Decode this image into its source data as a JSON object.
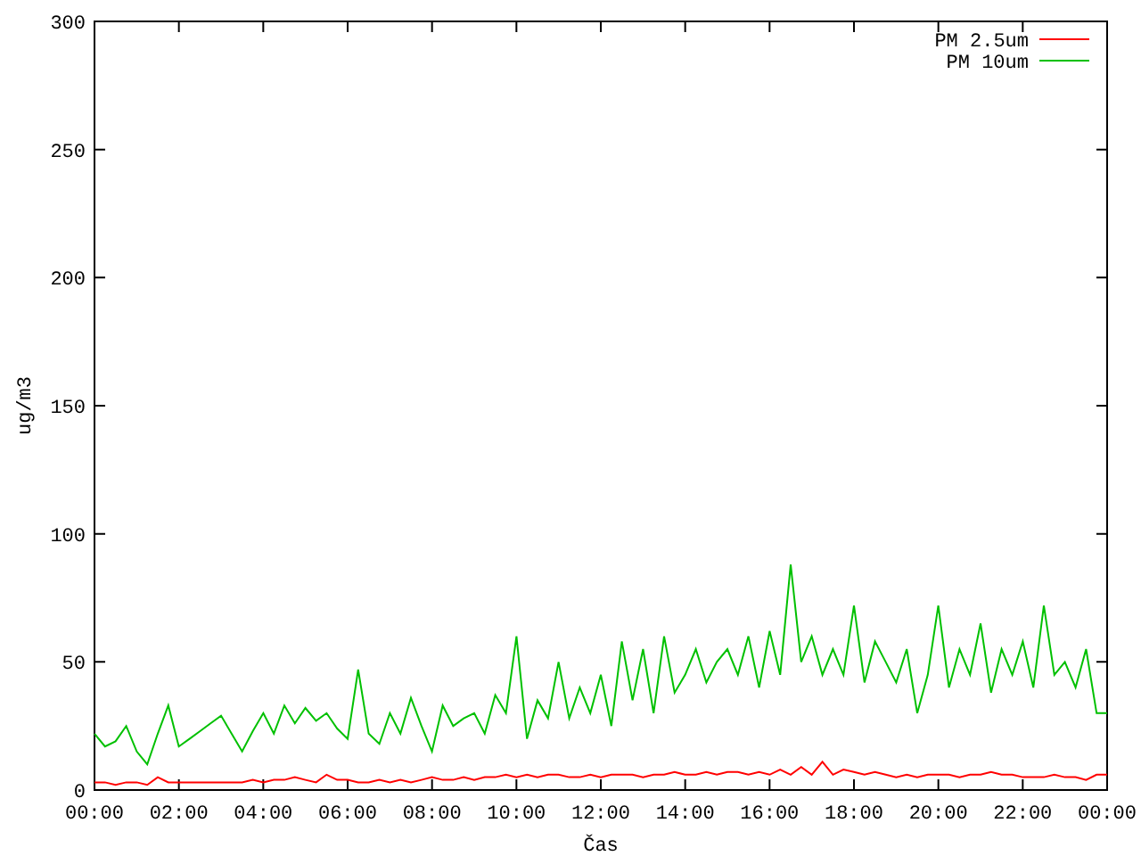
{
  "chart_data": {
    "type": "line",
    "xlabel": "Čas",
    "ylabel": "ug/m3",
    "x": [
      0,
      0.25,
      0.5,
      0.75,
      1,
      1.25,
      1.5,
      1.75,
      2,
      2.25,
      2.5,
      2.75,
      3,
      3.25,
      3.5,
      3.75,
      4,
      4.25,
      4.5,
      4.75,
      5,
      5.25,
      5.5,
      5.75,
      6,
      6.25,
      6.5,
      6.75,
      7,
      7.25,
      7.5,
      7.75,
      8,
      8.25,
      8.5,
      8.75,
      9,
      9.25,
      9.5,
      9.75,
      10,
      10.25,
      10.5,
      10.75,
      11,
      11.25,
      11.5,
      11.75,
      12,
      12.25,
      12.5,
      12.75,
      13,
      13.25,
      13.5,
      13.75,
      14,
      14.25,
      14.5,
      14.75,
      15,
      15.25,
      15.5,
      15.75,
      16,
      16.25,
      16.5,
      16.75,
      17,
      17.25,
      17.5,
      17.75,
      18,
      18.25,
      18.5,
      18.75,
      19,
      19.25,
      19.5,
      19.75,
      20,
      20.25,
      20.5,
      20.75,
      21,
      21.25,
      21.5,
      21.75,
      22,
      22.25,
      22.5,
      22.75,
      23,
      23.25,
      23.5,
      23.75,
      24
    ],
    "series": [
      {
        "name": "PM 2.5um",
        "color": "#ff0000",
        "values": [
          3,
          3,
          2,
          3,
          3,
          2,
          5,
          3,
          3,
          3,
          3,
          3,
          3,
          3,
          3,
          4,
          3,
          4,
          4,
          5,
          4,
          3,
          6,
          4,
          4,
          3,
          3,
          4,
          3,
          4,
          3,
          4,
          5,
          4,
          4,
          5,
          4,
          5,
          5,
          6,
          5,
          6,
          5,
          6,
          6,
          5,
          5,
          6,
          5,
          6,
          6,
          6,
          5,
          6,
          6,
          7,
          6,
          6,
          7,
          6,
          7,
          7,
          6,
          7,
          6,
          8,
          6,
          9,
          6,
          11,
          6,
          8,
          7,
          6,
          7,
          6,
          5,
          6,
          5,
          6,
          6,
          6,
          5,
          6,
          6,
          7,
          6,
          6,
          5,
          5,
          5,
          6,
          5,
          5,
          4,
          6,
          6
        ]
      },
      {
        "name": "PM 10um",
        "color": "#00c000",
        "values": [
          22,
          17,
          19,
          25,
          15,
          10,
          22,
          33,
          17,
          20,
          23,
          26,
          29,
          22,
          15,
          23,
          30,
          22,
          33,
          26,
          32,
          27,
          30,
          24,
          20,
          47,
          22,
          18,
          30,
          22,
          36,
          25,
          15,
          33,
          25,
          28,
          30,
          22,
          37,
          30,
          60,
          20,
          35,
          28,
          50,
          28,
          40,
          30,
          45,
          25,
          58,
          35,
          55,
          30,
          60,
          38,
          45,
          55,
          42,
          50,
          55,
          45,
          60,
          40,
          62,
          45,
          88,
          50,
          60,
          45,
          55,
          45,
          72,
          42,
          58,
          50,
          42,
          55,
          30,
          45,
          72,
          40,
          55,
          45,
          65,
          38,
          55,
          45,
          58,
          40,
          72,
          45,
          50,
          40,
          55,
          30,
          30
        ]
      }
    ],
    "xlim": [
      0,
      24
    ],
    "ylim": [
      0,
      300
    ],
    "xticks": [
      {
        "value": 0,
        "label": "00:00"
      },
      {
        "value": 2,
        "label": "02:00"
      },
      {
        "value": 4,
        "label": "04:00"
      },
      {
        "value": 6,
        "label": "06:00"
      },
      {
        "value": 8,
        "label": "08:00"
      },
      {
        "value": 10,
        "label": "10:00"
      },
      {
        "value": 12,
        "label": "12:00"
      },
      {
        "value": 14,
        "label": "14:00"
      },
      {
        "value": 16,
        "label": "16:00"
      },
      {
        "value": 18,
        "label": "18:00"
      },
      {
        "value": 20,
        "label": "20:00"
      },
      {
        "value": 22,
        "label": "22:00"
      },
      {
        "value": 24,
        "label": "00:00"
      }
    ],
    "yticks": [
      0,
      50,
      100,
      150,
      200,
      250,
      300
    ],
    "legend": true
  }
}
